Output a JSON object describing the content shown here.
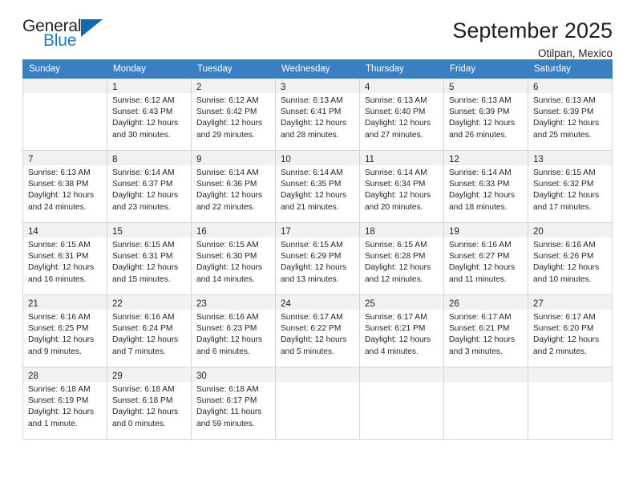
{
  "brand": {
    "name_top": "General",
    "name_bottom": "Blue",
    "flag_icon": "blue-triangle-flag-icon",
    "accent_color": "#1f7ac1"
  },
  "header": {
    "title": "September 2025",
    "subtitle": "Otilpan, Mexico"
  },
  "theme": {
    "header_row_bg": "#3a7fc1",
    "daynum_band_bg": "#f1f1f1",
    "grid_border": "#d4d4d4",
    "text": "#231f20"
  },
  "calendar": {
    "weekday_headers": [
      "Sunday",
      "Monday",
      "Tuesday",
      "Wednesday",
      "Thursday",
      "Friday",
      "Saturday"
    ],
    "weeks": [
      [
        {
          "blank": true
        },
        {
          "day": "1",
          "sunrise": "Sunrise: 6:12 AM",
          "sunset": "Sunset: 6:43 PM",
          "daylight1": "Daylight: 12 hours",
          "daylight2": "and 30 minutes."
        },
        {
          "day": "2",
          "sunrise": "Sunrise: 6:12 AM",
          "sunset": "Sunset: 6:42 PM",
          "daylight1": "Daylight: 12 hours",
          "daylight2": "and 29 minutes."
        },
        {
          "day": "3",
          "sunrise": "Sunrise: 6:13 AM",
          "sunset": "Sunset: 6:41 PM",
          "daylight1": "Daylight: 12 hours",
          "daylight2": "and 28 minutes."
        },
        {
          "day": "4",
          "sunrise": "Sunrise: 6:13 AM",
          "sunset": "Sunset: 6:40 PM",
          "daylight1": "Daylight: 12 hours",
          "daylight2": "and 27 minutes."
        },
        {
          "day": "5",
          "sunrise": "Sunrise: 6:13 AM",
          "sunset": "Sunset: 6:39 PM",
          "daylight1": "Daylight: 12 hours",
          "daylight2": "and 26 minutes."
        },
        {
          "day": "6",
          "sunrise": "Sunrise: 6:13 AM",
          "sunset": "Sunset: 6:39 PM",
          "daylight1": "Daylight: 12 hours",
          "daylight2": "and 25 minutes."
        }
      ],
      [
        {
          "day": "7",
          "sunrise": "Sunrise: 6:13 AM",
          "sunset": "Sunset: 6:38 PM",
          "daylight1": "Daylight: 12 hours",
          "daylight2": "and 24 minutes."
        },
        {
          "day": "8",
          "sunrise": "Sunrise: 6:14 AM",
          "sunset": "Sunset: 6:37 PM",
          "daylight1": "Daylight: 12 hours",
          "daylight2": "and 23 minutes."
        },
        {
          "day": "9",
          "sunrise": "Sunrise: 6:14 AM",
          "sunset": "Sunset: 6:36 PM",
          "daylight1": "Daylight: 12 hours",
          "daylight2": "and 22 minutes."
        },
        {
          "day": "10",
          "sunrise": "Sunrise: 6:14 AM",
          "sunset": "Sunset: 6:35 PM",
          "daylight1": "Daylight: 12 hours",
          "daylight2": "and 21 minutes."
        },
        {
          "day": "11",
          "sunrise": "Sunrise: 6:14 AM",
          "sunset": "Sunset: 6:34 PM",
          "daylight1": "Daylight: 12 hours",
          "daylight2": "and 20 minutes."
        },
        {
          "day": "12",
          "sunrise": "Sunrise: 6:14 AM",
          "sunset": "Sunset: 6:33 PM",
          "daylight1": "Daylight: 12 hours",
          "daylight2": "and 18 minutes."
        },
        {
          "day": "13",
          "sunrise": "Sunrise: 6:15 AM",
          "sunset": "Sunset: 6:32 PM",
          "daylight1": "Daylight: 12 hours",
          "daylight2": "and 17 minutes."
        }
      ],
      [
        {
          "day": "14",
          "sunrise": "Sunrise: 6:15 AM",
          "sunset": "Sunset: 6:31 PM",
          "daylight1": "Daylight: 12 hours",
          "daylight2": "and 16 minutes."
        },
        {
          "day": "15",
          "sunrise": "Sunrise: 6:15 AM",
          "sunset": "Sunset: 6:31 PM",
          "daylight1": "Daylight: 12 hours",
          "daylight2": "and 15 minutes."
        },
        {
          "day": "16",
          "sunrise": "Sunrise: 6:15 AM",
          "sunset": "Sunset: 6:30 PM",
          "daylight1": "Daylight: 12 hours",
          "daylight2": "and 14 minutes."
        },
        {
          "day": "17",
          "sunrise": "Sunrise: 6:15 AM",
          "sunset": "Sunset: 6:29 PM",
          "daylight1": "Daylight: 12 hours",
          "daylight2": "and 13 minutes."
        },
        {
          "day": "18",
          "sunrise": "Sunrise: 6:15 AM",
          "sunset": "Sunset: 6:28 PM",
          "daylight1": "Daylight: 12 hours",
          "daylight2": "and 12 minutes."
        },
        {
          "day": "19",
          "sunrise": "Sunrise: 6:16 AM",
          "sunset": "Sunset: 6:27 PM",
          "daylight1": "Daylight: 12 hours",
          "daylight2": "and 11 minutes."
        },
        {
          "day": "20",
          "sunrise": "Sunrise: 6:16 AM",
          "sunset": "Sunset: 6:26 PM",
          "daylight1": "Daylight: 12 hours",
          "daylight2": "and 10 minutes."
        }
      ],
      [
        {
          "day": "21",
          "sunrise": "Sunrise: 6:16 AM",
          "sunset": "Sunset: 6:25 PM",
          "daylight1": "Daylight: 12 hours",
          "daylight2": "and 9 minutes."
        },
        {
          "day": "22",
          "sunrise": "Sunrise: 6:16 AM",
          "sunset": "Sunset: 6:24 PM",
          "daylight1": "Daylight: 12 hours",
          "daylight2": "and 7 minutes."
        },
        {
          "day": "23",
          "sunrise": "Sunrise: 6:16 AM",
          "sunset": "Sunset: 6:23 PM",
          "daylight1": "Daylight: 12 hours",
          "daylight2": "and 6 minutes."
        },
        {
          "day": "24",
          "sunrise": "Sunrise: 6:17 AM",
          "sunset": "Sunset: 6:22 PM",
          "daylight1": "Daylight: 12 hours",
          "daylight2": "and 5 minutes."
        },
        {
          "day": "25",
          "sunrise": "Sunrise: 6:17 AM",
          "sunset": "Sunset: 6:21 PM",
          "daylight1": "Daylight: 12 hours",
          "daylight2": "and 4 minutes."
        },
        {
          "day": "26",
          "sunrise": "Sunrise: 6:17 AM",
          "sunset": "Sunset: 6:21 PM",
          "daylight1": "Daylight: 12 hours",
          "daylight2": "and 3 minutes."
        },
        {
          "day": "27",
          "sunrise": "Sunrise: 6:17 AM",
          "sunset": "Sunset: 6:20 PM",
          "daylight1": "Daylight: 12 hours",
          "daylight2": "and 2 minutes."
        }
      ],
      [
        {
          "day": "28",
          "sunrise": "Sunrise: 6:18 AM",
          "sunset": "Sunset: 6:19 PM",
          "daylight1": "Daylight: 12 hours",
          "daylight2": "and 1 minute."
        },
        {
          "day": "29",
          "sunrise": "Sunrise: 6:18 AM",
          "sunset": "Sunset: 6:18 PM",
          "daylight1": "Daylight: 12 hours",
          "daylight2": "and 0 minutes."
        },
        {
          "day": "30",
          "sunrise": "Sunrise: 6:18 AM",
          "sunset": "Sunset: 6:17 PM",
          "daylight1": "Daylight: 11 hours",
          "daylight2": "and 59 minutes."
        },
        {
          "blank": true
        },
        {
          "blank": true
        },
        {
          "blank": true
        },
        {
          "blank": true
        }
      ]
    ]
  }
}
